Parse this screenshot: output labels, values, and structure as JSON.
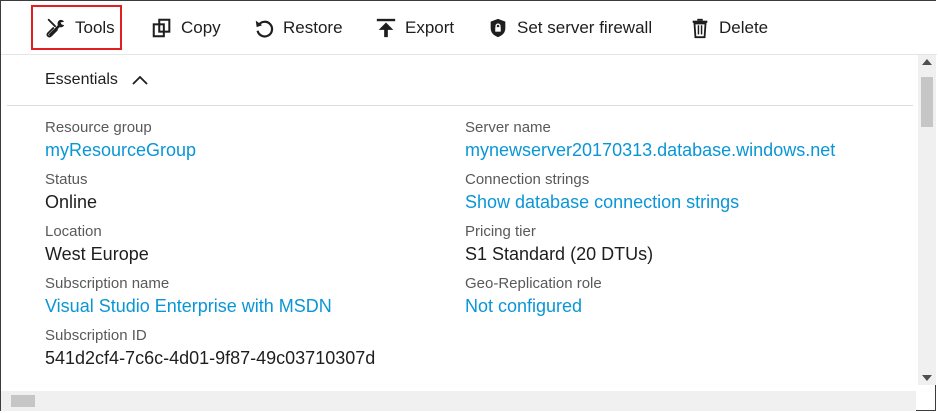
{
  "toolbar": {
    "buttons": [
      {
        "label": "Tools",
        "icon": "tools-icon"
      },
      {
        "label": "Copy",
        "icon": "copy-icon"
      },
      {
        "label": "Restore",
        "icon": "restore-icon"
      },
      {
        "label": "Export",
        "icon": "export-icon"
      },
      {
        "label": "Set server firewall",
        "icon": "shield-icon"
      },
      {
        "label": "Delete",
        "icon": "trash-icon"
      }
    ]
  },
  "essentials": {
    "title": "Essentials",
    "left": [
      {
        "label": "Resource group",
        "value": "myResourceGroup"
      },
      {
        "label": "Status",
        "value": "Online"
      },
      {
        "label": "Location",
        "value": "West Europe"
      },
      {
        "label": "Subscription name",
        "value": "Visual Studio Enterprise with MSDN"
      },
      {
        "label": "Subscription ID",
        "value": "541d2cf4-7c6c-4d01-9f87-49c03710307d"
      }
    ],
    "right": [
      {
        "label": "Server name",
        "value": "mynewserver20170313.database.windows.net"
      },
      {
        "label": "Connection strings",
        "value": "Show database connection strings"
      },
      {
        "label": "Pricing tier",
        "value": "S1 Standard (20 DTUs)"
      },
      {
        "label": "Geo-Replication role",
        "value": "Not configured"
      }
    ]
  },
  "colors": {
    "link": "#0a96d6",
    "highlight": "#e02020"
  }
}
